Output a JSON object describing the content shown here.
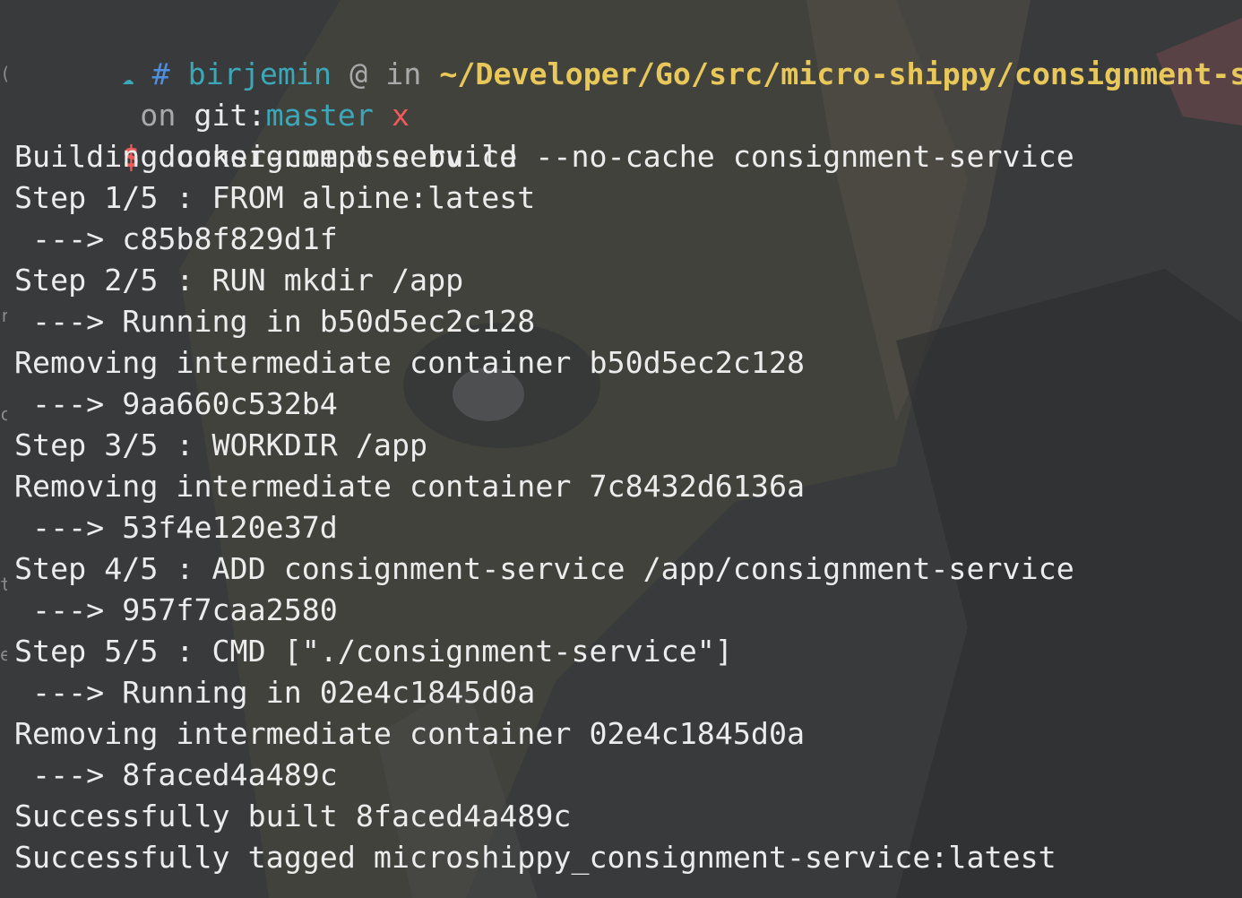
{
  "prompt": {
    "arrow_glyph": "☁",
    "hash": "#",
    "user": "birjemin",
    "at": "@",
    "in": "in",
    "path": "~/Developer/Go/src/micro-shippy/consignment-service",
    "on": "on",
    "git_label": "git:",
    "branch": "master",
    "dirty": "x",
    "dollar": "$",
    "command": "docker-compose build --no-cache consignment-service"
  },
  "output": [
    "Building consignment-service",
    "Step 1/5 : FROM alpine:latest",
    " ---> c85b8f829d1f",
    "Step 2/5 : RUN mkdir /app",
    " ---> Running in b50d5ec2c128",
    "Removing intermediate container b50d5ec2c128",
    " ---> 9aa660c532b4",
    "Step 3/5 : WORKDIR /app",
    "Removing intermediate container 7c8432d6136a",
    " ---> 53f4e120e37d",
    "Step 4/5 : ADD consignment-service /app/consignment-service",
    " ---> 957f7caa2580",
    "Step 5/5 : CMD [\"./consignment-service\"]",
    " ---> Running in 02e4c1845d0a",
    "Removing intermediate container 02e4c1845d0a",
    " ---> 8faced4a489c",
    "Successfully built 8faced4a489c",
    "Successfully tagged microshippy_consignment-service:latest"
  ],
  "colors": {
    "background": "#3a3b3c",
    "text": "#ececec",
    "user": "#3aa8b8",
    "path": "#e8c85a",
    "branch": "#3aa8b8",
    "dirty": "#f05a5a",
    "dollar": "#ef5b5b"
  }
}
